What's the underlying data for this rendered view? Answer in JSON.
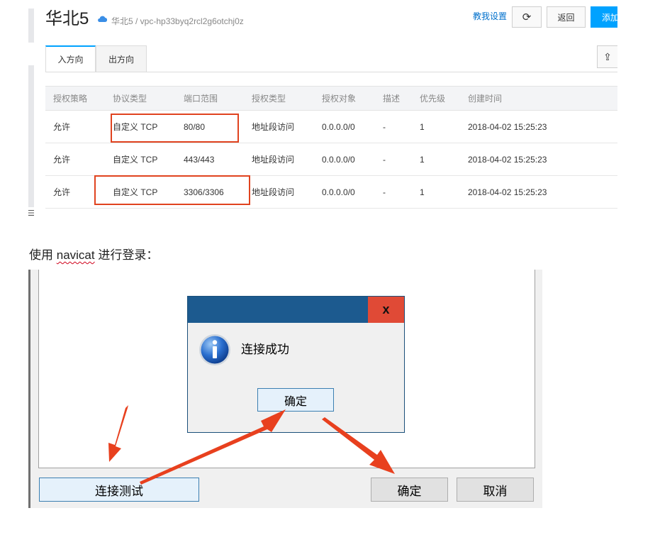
{
  "console": {
    "title": "华北5",
    "subtitle": "华北5 / vpc-hp33byq2rcl2g6otchj0z",
    "help_link": "教我设置",
    "refresh_glyph": "⟳",
    "back_button": "返回",
    "add_button": "添加",
    "export_glyph": "⇪",
    "left_glyph": "☰",
    "tabs": [
      {
        "label": "入方向",
        "active": true
      },
      {
        "label": "出方向",
        "active": false
      }
    ],
    "columns": [
      "授权策略",
      "协议类型",
      "端口范围",
      "授权类型",
      "授权对象",
      "描述",
      "优先级",
      "创建时间"
    ],
    "rows": [
      [
        "允许",
        "自定义 TCP",
        "80/80",
        "地址段访问",
        "0.0.0.0/0",
        "-",
        "1",
        "2018-04-02 15:25:23"
      ],
      [
        "允许",
        "自定义 TCP",
        "443/443",
        "地址段访问",
        "0.0.0.0/0",
        "-",
        "1",
        "2018-04-02 15:25:23"
      ],
      [
        "允许",
        "自定义 TCP",
        "3306/3306",
        "地址段访问",
        "0.0.0.0/0",
        "-",
        "1",
        "2018-04-02 15:25:23"
      ]
    ],
    "accent_color": "#00a2ff"
  },
  "caption": {
    "prefix": "使用 ",
    "word": "navicat",
    "suffix": " 进行登录："
  },
  "navicat": {
    "dialog": {
      "close_glyph": "x",
      "message": "连接成功",
      "ok_button": "确定"
    },
    "buttons": {
      "test": "连接测试",
      "ok": "确定",
      "cancel": "取消"
    }
  },
  "annotation_color": "#e8401e"
}
